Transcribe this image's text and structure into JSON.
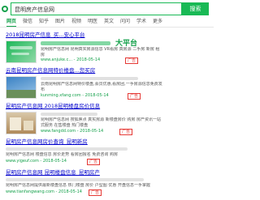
{
  "search": {
    "query": "昆明房产信息网",
    "button_label": "搜索"
  },
  "tabs": [
    {
      "label": "网页",
      "active": true
    },
    {
      "label": "微信",
      "active": false
    },
    {
      "label": "知乎",
      "active": false
    },
    {
      "label": "图片",
      "active": false
    },
    {
      "label": "视频",
      "active": false
    },
    {
      "label": "明医",
      "active": false
    },
    {
      "label": "英文",
      "active": false
    },
    {
      "label": "问问",
      "active": false
    },
    {
      "label": "学术",
      "active": false
    },
    {
      "label": "更多",
      "active": false
    }
  ],
  "results": [
    {
      "title": "2018昆明房产信息_买...安心平台",
      "headline": "大平台",
      "snippet": "昆明房产信息网 昆明真实房源信息 VR看房 真房源 二手房 新房 租房",
      "url": "www.anjuke.c... - 2018-05-14",
      "ad": "广告"
    },
    {
      "title": "云南昆明房产信息网特价楼盘...您买房",
      "snippet": "云南昆明房产信息网特价楼盘,会员优惠,看房团,一手房源信息免费发布",
      "url": "kunming.xfang.com - 2018-05-14",
      "ad": "广告"
    },
    {
      "title": "昆明房产信息网 2018昆明楼盘房价信息",
      "snippet": "昆明房产信息网 搜狐焦点 真实房源 新楼盘房价 购房 房产资讯一站式服务 在售楼盘 热门楼盘",
      "url": "www.fangdd.com - 2018-05-14",
      "ad": "广告"
    },
    {
      "title": "昆明房产信息网房价查询_昆明新房",
      "snippet": "昆明房产信息网 楼盘信息 房价走势 看房团报名 免费咨询 购房",
      "url": "www.yigeuf.com - 2018-05-14",
      "ad": "广告"
    },
    {
      "title": "昆明房产信息网 昆明楼盘信息_昆明房产",
      "snippet": "昆明房产信息网提供最新楼盘信息 热门楼盘 房价 户型图 优惠 开盘信息一手掌握",
      "url": "www.tianfangwang.com - 2018-05-14",
      "ad": "广告"
    }
  ],
  "colors": {
    "brand_green": "#15a14b",
    "link_blue": "#0000cc",
    "ad_red": "#e53935"
  }
}
